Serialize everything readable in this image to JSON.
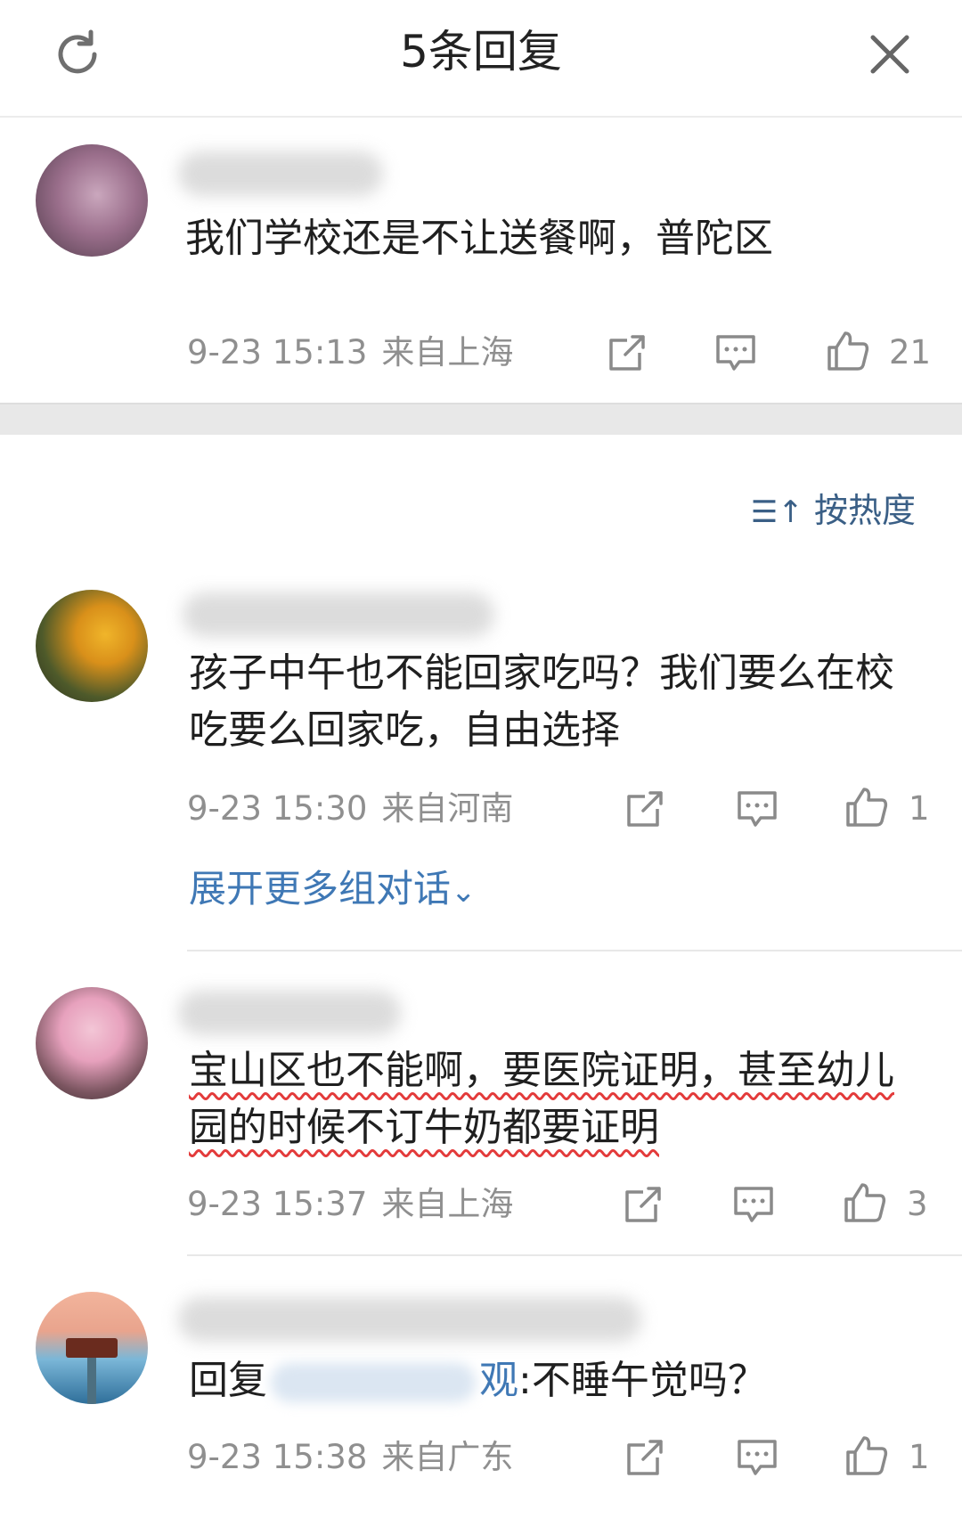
{
  "header": {
    "title": "5条回复",
    "refresh_icon": "refresh-icon",
    "close_icon": "close-icon"
  },
  "root_comment": {
    "text": "我们学校还是不让送餐啊，普陀区",
    "time": "9-23 15:13",
    "location": "来自上海",
    "likes": "21"
  },
  "sort": {
    "label": "按热度",
    "icon": "sort-icon"
  },
  "replies": [
    {
      "text": "孩子中午也不能回家吃吗？我们要么在校吃要么回家吃，自由选择",
      "time": "9-23 15:30",
      "location": "来自河南",
      "likes": "1"
    },
    {
      "text": "宝山区也不能啊，要医院证明，甚至幼儿园的时候不订牛奶都要证明",
      "time": "9-23 15:37",
      "location": "来自上海",
      "likes": "3"
    },
    {
      "text_prefix": "回复",
      "mention_suffix": "观",
      "text_suffix": ":不睡午觉吗？",
      "time": "9-23 15:38",
      "location": "来自广东",
      "likes": "1"
    }
  ],
  "expand_label": "展开更多组对话",
  "colors": {
    "link": "#3f78b5",
    "meta": "#8f8f8f",
    "band": "#e8e8e8",
    "underline": "#e33b3b"
  }
}
